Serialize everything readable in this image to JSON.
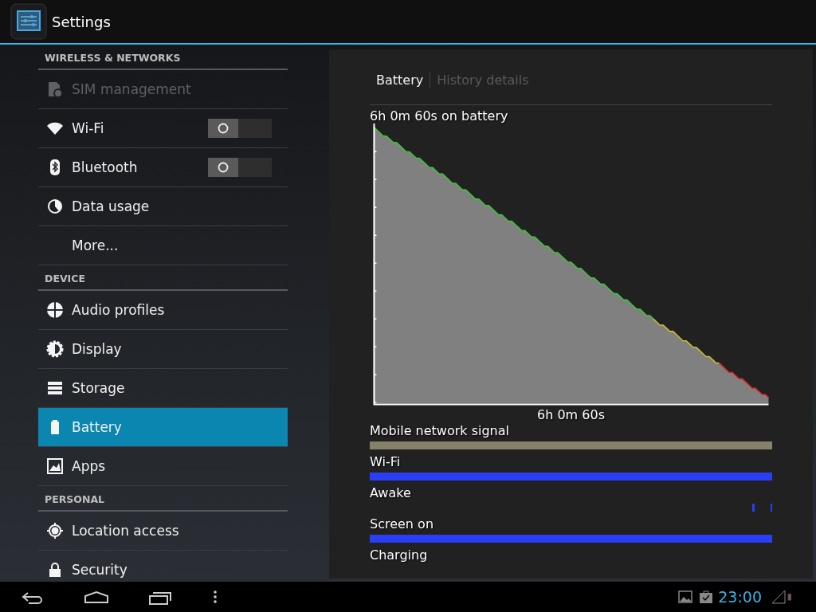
{
  "action_bar": {
    "title": "Settings"
  },
  "sidebar": {
    "sections": [
      {
        "header": "WIRELESS & NETWORKS",
        "items": [
          {
            "label": "SIM management",
            "disabled": true,
            "selected": false
          },
          {
            "label": "Wi-Fi",
            "kind": "toggle",
            "on": false,
            "disabled": false,
            "selected": false
          },
          {
            "label": "Bluetooth",
            "kind": "toggle",
            "on": false,
            "disabled": false,
            "selected": false
          },
          {
            "label": "Data usage",
            "disabled": false,
            "selected": false
          },
          {
            "label": "More...",
            "disabled": false,
            "selected": false
          }
        ]
      },
      {
        "header": "DEVICE",
        "items": [
          {
            "label": "Audio profiles",
            "disabled": false,
            "selected": false
          },
          {
            "label": "Display",
            "disabled": false,
            "selected": false
          },
          {
            "label": "Storage",
            "disabled": false,
            "selected": false
          },
          {
            "label": "Battery",
            "disabled": false,
            "selected": true
          },
          {
            "label": "Apps",
            "disabled": false,
            "selected": false
          }
        ]
      },
      {
        "header": "PERSONAL",
        "items": [
          {
            "label": "Location access",
            "disabled": false,
            "selected": false
          },
          {
            "label": "Security",
            "disabled": false,
            "selected": false
          }
        ]
      }
    ]
  },
  "detail": {
    "tabs": [
      {
        "label": "Battery",
        "selected": true
      },
      {
        "label": "History details",
        "selected": false
      }
    ],
    "graph_title": "6h 0m 60s on battery",
    "graph_duration": "6h 0m 60s",
    "timelines": [
      {
        "label": "Mobile network signal",
        "kind": "signal"
      },
      {
        "label": "Wi-Fi",
        "kind": "bar"
      },
      {
        "label": "Awake",
        "kind": "ticks"
      },
      {
        "label": "Screen on",
        "kind": "bar"
      },
      {
        "label": "Charging",
        "kind": "empty"
      }
    ]
  },
  "status_bar": {
    "time": "23:00"
  }
}
